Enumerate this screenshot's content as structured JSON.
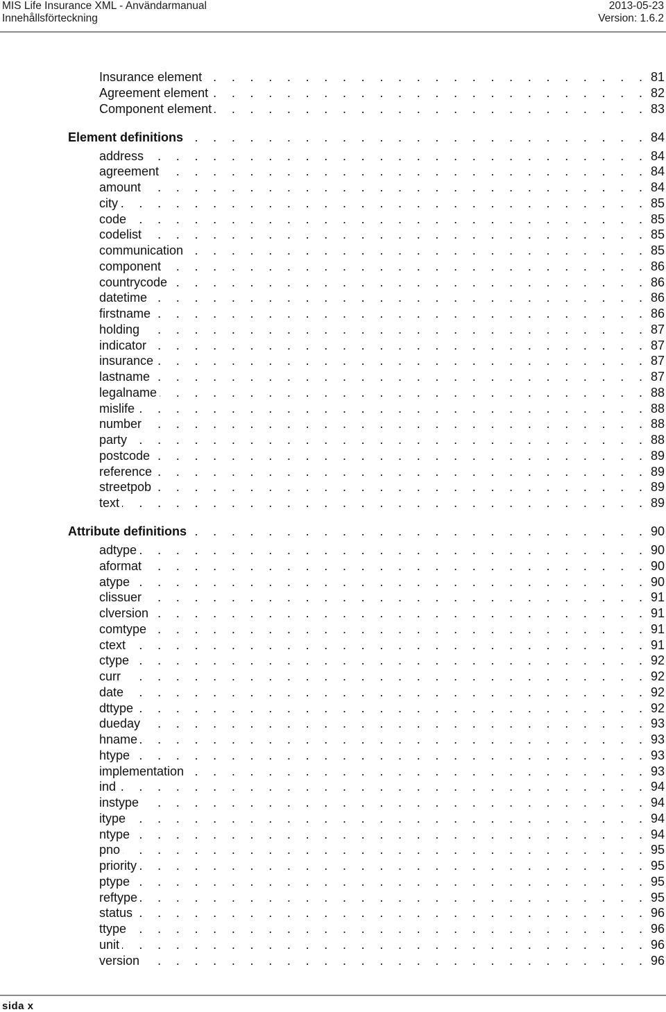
{
  "header": {
    "title": "MIS Life Insurance XML - Användarmanual",
    "subtitle": "Innehållsförteckning",
    "date": "2013-05-23",
    "version": "Version: 1.6.2"
  },
  "footer": {
    "page_label": "sida  x"
  },
  "toc": [
    {
      "level": "sub",
      "label": "Insurance element",
      "page": "81"
    },
    {
      "level": "sub",
      "label": "Agreement element",
      "page": "82"
    },
    {
      "level": "sub",
      "label": "Component element",
      "page": "83"
    },
    {
      "level": "sec",
      "label": "Element definitions",
      "page": "84"
    },
    {
      "level": "sub",
      "label": "address",
      "page": "84"
    },
    {
      "level": "sub",
      "label": "agreement",
      "page": "84"
    },
    {
      "level": "sub",
      "label": "amount",
      "page": "84"
    },
    {
      "level": "sub",
      "label": "city",
      "page": "85"
    },
    {
      "level": "sub",
      "label": "code",
      "page": "85"
    },
    {
      "level": "sub",
      "label": "codelist",
      "page": "85"
    },
    {
      "level": "sub",
      "label": "communication",
      "page": "85"
    },
    {
      "level": "sub",
      "label": "component",
      "page": "86"
    },
    {
      "level": "sub",
      "label": "countrycode",
      "page": "86"
    },
    {
      "level": "sub",
      "label": "datetime",
      "page": "86"
    },
    {
      "level": "sub",
      "label": "firstname",
      "page": "86"
    },
    {
      "level": "sub",
      "label": "holding",
      "page": "87"
    },
    {
      "level": "sub",
      "label": "indicator",
      "page": "87"
    },
    {
      "level": "sub",
      "label": "insurance",
      "page": "87"
    },
    {
      "level": "sub",
      "label": "lastname",
      "page": "87"
    },
    {
      "level": "sub",
      "label": "legalname",
      "page": "88"
    },
    {
      "level": "sub",
      "label": "mislife",
      "page": "88"
    },
    {
      "level": "sub",
      "label": "number",
      "page": "88"
    },
    {
      "level": "sub",
      "label": "party",
      "page": "88"
    },
    {
      "level": "sub",
      "label": "postcode",
      "page": "89"
    },
    {
      "level": "sub",
      "label": "reference",
      "page": "89"
    },
    {
      "level": "sub",
      "label": "streetpob",
      "page": "89"
    },
    {
      "level": "sub",
      "label": "text",
      "page": "89"
    },
    {
      "level": "sec",
      "label": "Attribute definitions",
      "page": "90"
    },
    {
      "level": "sub",
      "label": "adtype",
      "page": "90"
    },
    {
      "level": "sub",
      "label": "aformat",
      "page": "90"
    },
    {
      "level": "sub",
      "label": "atype",
      "page": "90"
    },
    {
      "level": "sub",
      "label": "clissuer",
      "page": "91"
    },
    {
      "level": "sub",
      "label": "clversion",
      "page": "91"
    },
    {
      "level": "sub",
      "label": "comtype",
      "page": "91"
    },
    {
      "level": "sub",
      "label": "ctext",
      "page": "91"
    },
    {
      "level": "sub",
      "label": "ctype",
      "page": "92"
    },
    {
      "level": "sub",
      "label": "curr",
      "page": "92"
    },
    {
      "level": "sub",
      "label": "date",
      "page": "92"
    },
    {
      "level": "sub",
      "label": "dttype",
      "page": "92"
    },
    {
      "level": "sub",
      "label": "dueday",
      "page": "93"
    },
    {
      "level": "sub",
      "label": "hname",
      "page": "93"
    },
    {
      "level": "sub",
      "label": "htype",
      "page": "93"
    },
    {
      "level": "sub",
      "label": "implementation",
      "page": "93"
    },
    {
      "level": "sub",
      "label": "ind",
      "page": "94"
    },
    {
      "level": "sub",
      "label": "instype",
      "page": "94"
    },
    {
      "level": "sub",
      "label": "itype",
      "page": "94"
    },
    {
      "level": "sub",
      "label": "ntype",
      "page": "94"
    },
    {
      "level": "sub",
      "label": "pno",
      "page": "95"
    },
    {
      "level": "sub",
      "label": "priority",
      "page": "95"
    },
    {
      "level": "sub",
      "label": "ptype",
      "page": "95"
    },
    {
      "level": "sub",
      "label": "reftype",
      "page": "95"
    },
    {
      "level": "sub",
      "label": "status",
      "page": "96"
    },
    {
      "level": "sub",
      "label": "ttype",
      "page": "96"
    },
    {
      "level": "sub",
      "label": "unit",
      "page": "96"
    },
    {
      "level": "sub",
      "label": "version",
      "page": "96"
    }
  ]
}
